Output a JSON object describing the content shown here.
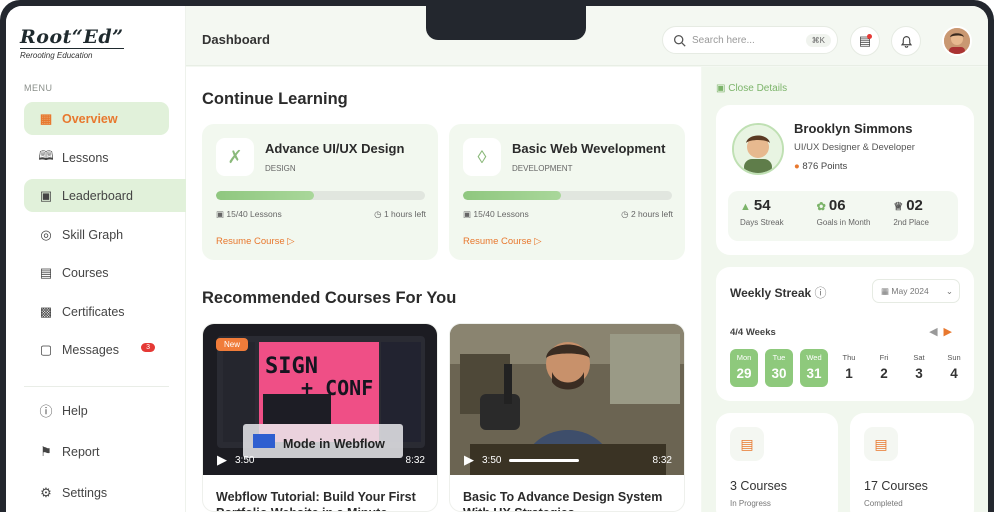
{
  "brand": {
    "name": "Root“Ed”",
    "tagline": "Rerooting Education"
  },
  "sidebar": {
    "menu_label": "MENU",
    "items": [
      {
        "label": "Overview",
        "icon": "grid-icon",
        "active": true
      },
      {
        "label": "Lessons",
        "icon": "book-icon"
      },
      {
        "label": "Leaderboard",
        "icon": "monitor-icon"
      },
      {
        "label": "Skill Graph",
        "icon": "target-icon"
      },
      {
        "label": "Courses",
        "icon": "document-icon"
      },
      {
        "label": "Certificates",
        "icon": "certificate-icon"
      },
      {
        "label": "Messages",
        "icon": "message-icon",
        "badge": "3"
      }
    ],
    "bottom_items": [
      {
        "label": "Help",
        "icon": "info-icon"
      },
      {
        "label": "Report",
        "icon": "flag-icon"
      },
      {
        "label": "Settings",
        "icon": "gear-icon"
      }
    ]
  },
  "header": {
    "title": "Dashboard",
    "search_placeholder": "Search here...",
    "search_shortcut": "⌘K"
  },
  "continue_learning": {
    "title": "Continue Learning",
    "courses": [
      {
        "title": "Advance UI/UX Design",
        "category": "DESIGN",
        "lessons": "15/40 Lessons",
        "time_left": "1 hours left",
        "progress": 0.47,
        "resume": "Resume Course",
        "icon": "pen-tool-icon"
      },
      {
        "title": "Basic Web Wevelopment",
        "category": "DEVELOPMENT",
        "lessons": "15/40 Lessons",
        "time_left": "2 hours left",
        "progress": 0.47,
        "resume": "Resume Course",
        "icon": "html5-icon"
      }
    ]
  },
  "recommended": {
    "title": "Recommended Courses For You",
    "videos": [
      {
        "title": "Webflow Tutorial: Build Your First Portfolio Website in a Minute",
        "tag": "New",
        "current": "3:50",
        "duration": "8:32",
        "caption": "Mode in Webflow",
        "poster_line1": "SIGN",
        "poster_line2": "+ CONF"
      },
      {
        "title": "Basic To Advance Design System With UX Strategies",
        "current": "3:50",
        "duration": "8:32"
      }
    ]
  },
  "profile": {
    "close_label": "Close Details",
    "name": "Brooklyn Simmons",
    "role": "UI/UX Designer & Developer",
    "points": "876 Points",
    "stats": [
      {
        "value": "54",
        "label": "Days Streak",
        "icon": "fire-icon"
      },
      {
        "value": "06",
        "label": "Goals in Month",
        "icon": "leaf-icon"
      },
      {
        "value": "02",
        "label": "2nd Place",
        "icon": "trophy-icon"
      }
    ]
  },
  "weekly_streak": {
    "title": "Weekly Streak",
    "month": "May 2024",
    "weeks": "4/4 Weeks",
    "days": [
      {
        "name": "Mon",
        "date": "29",
        "done": true
      },
      {
        "name": "Tue",
        "date": "30",
        "done": true
      },
      {
        "name": "Wed",
        "date": "31",
        "done": true
      },
      {
        "name": "Thu",
        "date": "1",
        "done": false
      },
      {
        "name": "Fri",
        "date": "2",
        "done": false
      },
      {
        "name": "Sat",
        "date": "3",
        "done": false
      },
      {
        "name": "Sun",
        "date": "4",
        "done": false
      }
    ]
  },
  "summary": [
    {
      "value": "3 Courses",
      "label": "In Progress"
    },
    {
      "value": "17 Courses",
      "label": "Completed"
    }
  ],
  "colors": {
    "accent": "#e8782e",
    "green": "#8ec97c",
    "active_bg": "#e1f1da"
  }
}
